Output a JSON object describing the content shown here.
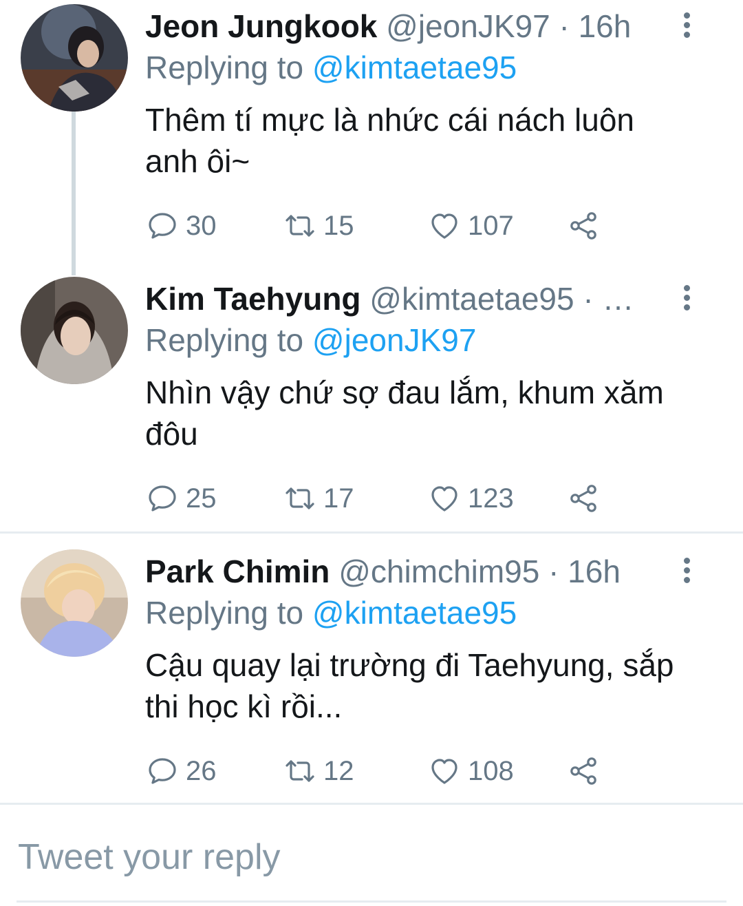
{
  "colors": {
    "accent": "#1da1f2",
    "secondary_text": "#657786",
    "divider": "#e6ecf0"
  },
  "tweets": [
    {
      "name": "Jeon Jungkook",
      "handle": "@jeonJK97",
      "time": "16h",
      "meta": "@jeonJK97 · 16h",
      "replying_prefix": "Replying to ",
      "replying_to": "@kimtaetae95",
      "text": "Thêm tí mực là nhức cái nách luôn anh ôi~",
      "replies": "30",
      "retweets": "15",
      "likes": "107"
    },
    {
      "name": "Kim Taehyung",
      "handle": "@kimtaetae95",
      "meta": "@kimtaetae95 · …",
      "replying_prefix": "Replying to ",
      "replying_to": "@jeonJK97",
      "text": "Nhìn vậy chứ sợ đau lắm, khum xăm đôu",
      "replies": "25",
      "retweets": "17",
      "likes": "123"
    },
    {
      "name": "Park Chimin",
      "handle": "@chimchim95",
      "time": "16h",
      "meta": "@chimchim95 · 16h",
      "replying_prefix": "Replying to ",
      "replying_to": "@kimtaetae95",
      "text": "Cậu quay lại trường đi Taehyung, sắp thi học kì rồi...",
      "replies": "26",
      "retweets": "12",
      "likes": "108"
    }
  ],
  "compose": {
    "placeholder": "Tweet your reply"
  },
  "icons": {
    "reply": "reply-icon",
    "retweet": "retweet-icon",
    "like": "heart-icon",
    "share": "share-icon",
    "more": "more-vertical-icon"
  }
}
